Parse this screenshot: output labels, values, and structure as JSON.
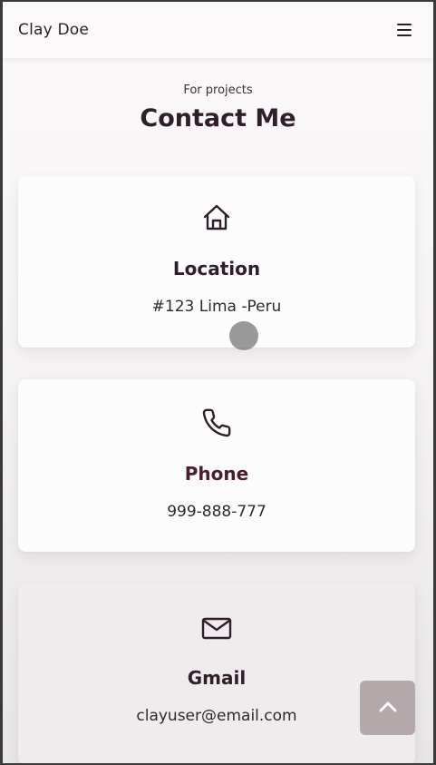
{
  "header": {
    "brand": "Clay Doe",
    "menu_icon": "hamburger-menu-icon"
  },
  "section": {
    "subtitle": "For projects",
    "title": "Contact Me"
  },
  "cards": [
    {
      "icon": "home-icon",
      "title": "Location",
      "value": "#123 Lima -Peru"
    },
    {
      "icon": "phone-icon",
      "title": "Phone",
      "value": "999-888-777"
    },
    {
      "icon": "mail-icon",
      "title": "Gmail",
      "value": "clayuser@email.com"
    }
  ],
  "scroll_top": {
    "icon": "chevron-up-icon"
  },
  "colors": {
    "title_dark": "#2e1f2a",
    "card_title_maroon": "#4a1e2c",
    "scroll_button": "#b5a8ab"
  }
}
